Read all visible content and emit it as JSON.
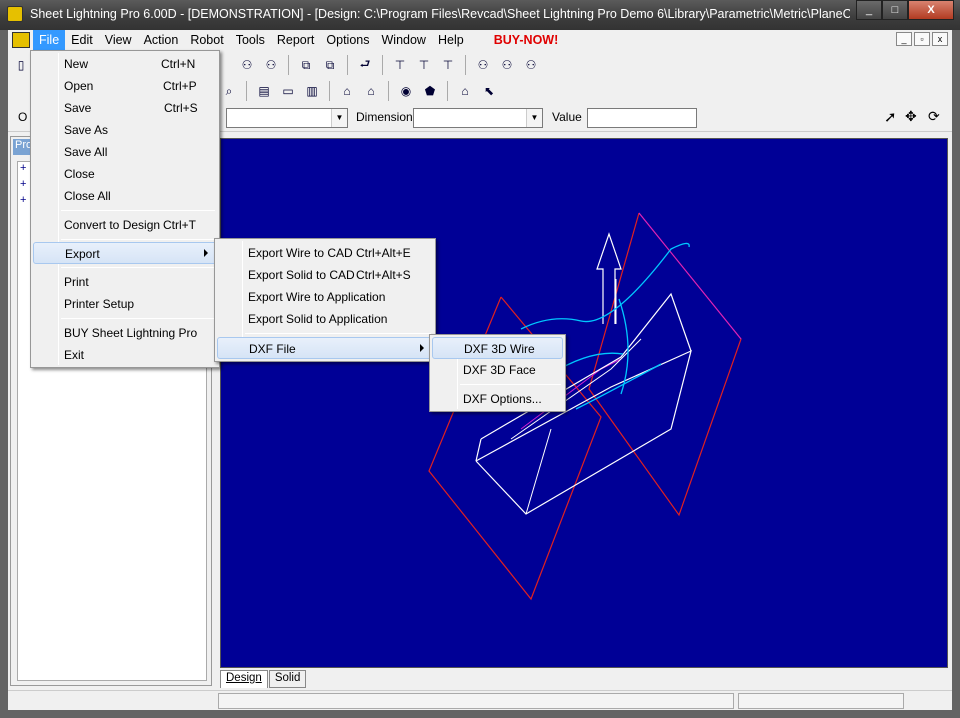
{
  "title": "Sheet Lightning Pro 6.00D - [DEMONSTRATION] - [Design: C:\\Program Files\\Revcad\\Sheet Lightning Pro Demo 6\\Library\\Parametric\\Metric\\PlaneCut\\Sq...",
  "window_buttons": {
    "minimize": "_",
    "maximize": "□",
    "close": "X"
  },
  "menubar": [
    {
      "label": "File"
    },
    {
      "label": "Edit"
    },
    {
      "label": "View"
    },
    {
      "label": "Action"
    },
    {
      "label": "Robot"
    },
    {
      "label": "Tools"
    },
    {
      "label": "Report"
    },
    {
      "label": "Options"
    },
    {
      "label": "Window"
    },
    {
      "label": "Help"
    }
  ],
  "buy_now": "BUY-NOW!",
  "controls": {
    "dimension_label": "Dimension",
    "value_label": "Value",
    "left_label": "O"
  },
  "left_panel": {
    "tab": "Pro",
    "tree_markers": [
      "+",
      "+",
      "+"
    ]
  },
  "tabs": [
    "Design",
    "Solid"
  ],
  "file_menu": {
    "items": [
      {
        "label": "New",
        "shortcut": "Ctrl+N"
      },
      {
        "label": "Open",
        "shortcut": "Ctrl+P"
      },
      {
        "label": "Save",
        "shortcut": "Ctrl+S"
      },
      {
        "label": "Save As",
        "shortcut": ""
      },
      {
        "label": "Save All",
        "shortcut": ""
      },
      {
        "label": "Close",
        "shortcut": ""
      },
      {
        "label": "Close All",
        "shortcut": ""
      },
      {
        "label": "Convert to Design",
        "shortcut": "Ctrl+T"
      },
      {
        "label": "Export",
        "shortcut": ""
      },
      {
        "label": "Print",
        "shortcut": ""
      },
      {
        "label": "Printer Setup",
        "shortcut": ""
      },
      {
        "label": "BUY Sheet Lightning Pro",
        "shortcut": ""
      },
      {
        "label": "Exit",
        "shortcut": ""
      }
    ]
  },
  "export_menu": {
    "items": [
      {
        "label": "Export Wire to CAD",
        "shortcut": "Ctrl+Alt+E"
      },
      {
        "label": "Export Solid to CAD",
        "shortcut": "Ctrl+Alt+S"
      },
      {
        "label": "Export Wire to Application",
        "shortcut": ""
      },
      {
        "label": "Export Solid to Application",
        "shortcut": ""
      },
      {
        "label": "DXF File",
        "shortcut": ""
      }
    ]
  },
  "dxf_menu": {
    "items": [
      {
        "label": "DXF 3D Wire"
      },
      {
        "label": "DXF 3D Face"
      },
      {
        "label": "DXF Options..."
      }
    ]
  },
  "colors": {
    "canvas": "#000096",
    "wire": "#ffffff",
    "plane": "#e02020",
    "accent": "#00e0ff",
    "highlight": "#3399ff",
    "buy": "#e00000"
  }
}
